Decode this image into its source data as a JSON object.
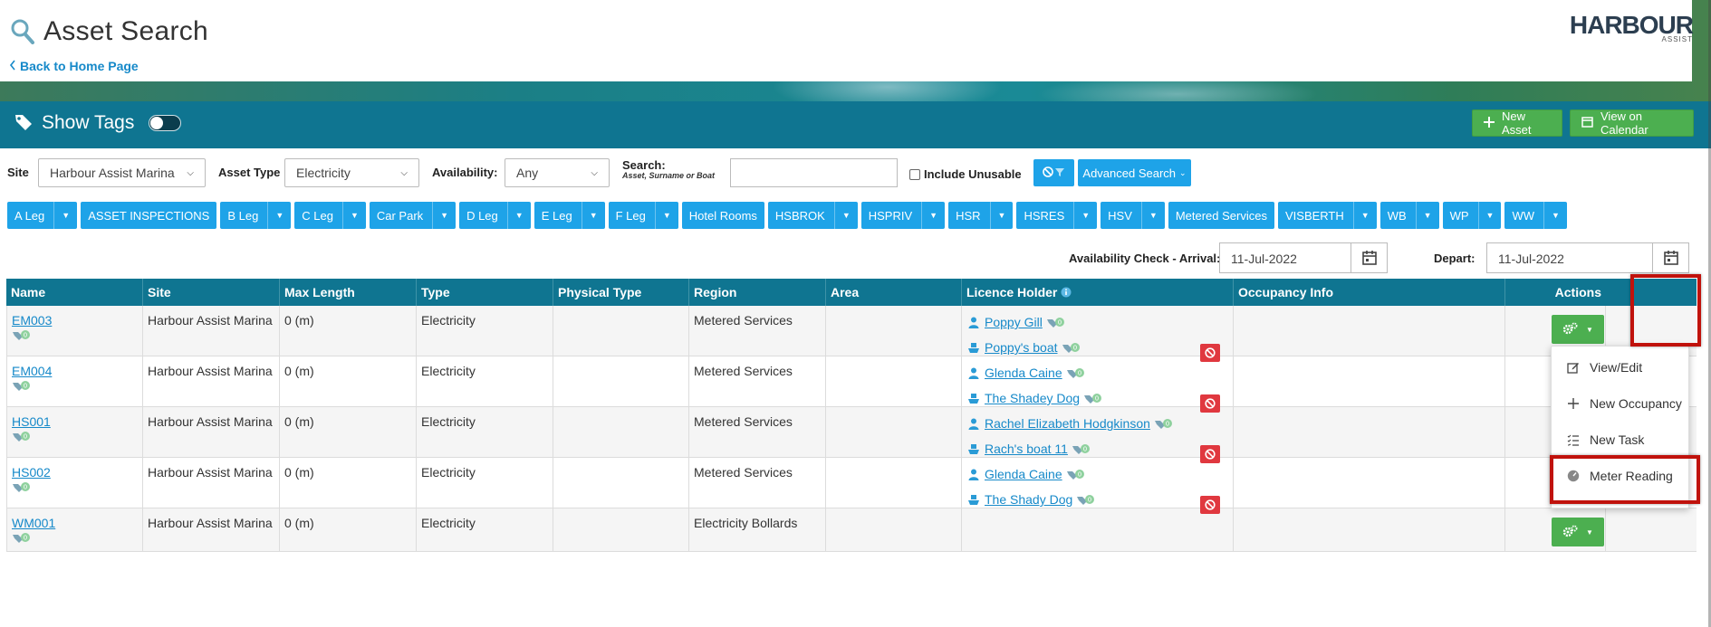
{
  "header": {
    "title": "Asset Search",
    "back_link": "Back to Home Page",
    "logo_word": "HARBOUR",
    "logo_sub": "ASSIST"
  },
  "toolbar": {
    "show_tags": "Show Tags",
    "new_asset": "New Asset",
    "view_calendar": "View on Calendar"
  },
  "filters": {
    "site_label": "Site",
    "site_value": "Harbour Assist Marina",
    "asset_type_label": "Asset Type",
    "asset_type_value": "Electricity",
    "availability_label": "Availability:",
    "availability_value": "Any",
    "search_label": "Search:",
    "search_hint": "Asset, Surname or Boat",
    "search_value": "",
    "include_unusable": "Include Unusable",
    "advanced_search": "Advanced Search"
  },
  "region_tags": [
    {
      "label": "A Leg",
      "caret": true
    },
    {
      "label": "ASSET INSPECTIONS",
      "caret": false
    },
    {
      "label": "B Leg",
      "caret": true
    },
    {
      "label": "C Leg",
      "caret": true
    },
    {
      "label": "Car Park",
      "caret": true
    },
    {
      "label": "D Leg",
      "caret": true
    },
    {
      "label": "E Leg",
      "caret": true
    },
    {
      "label": "F Leg",
      "caret": true
    },
    {
      "label": "Hotel Rooms",
      "caret": false
    },
    {
      "label": "HSBROK",
      "caret": true
    },
    {
      "label": "HSPRIV",
      "caret": true
    },
    {
      "label": "HSR",
      "caret": true
    },
    {
      "label": "HSRES",
      "caret": true
    },
    {
      "label": "HSV",
      "caret": true
    },
    {
      "label": "Metered Services",
      "caret": false
    },
    {
      "label": "VISBERTH",
      "caret": true
    },
    {
      "label": "WB",
      "caret": true
    },
    {
      "label": "WP",
      "caret": true
    },
    {
      "label": "WW",
      "caret": true
    }
  ],
  "availability": {
    "arrival_label": "Availability Check - Arrival:",
    "arrival_value": "11-Jul-2022",
    "depart_label": "Depart:",
    "depart_value": "11-Jul-2022"
  },
  "table": {
    "columns": [
      "Name",
      "Site",
      "Max Length",
      "Type",
      "Physical Type",
      "Region",
      "Area",
      "Licence Holder",
      "Occupancy Info",
      "Actions"
    ],
    "rows": [
      {
        "name": "EM003",
        "site": "Harbour Assist Marina",
        "max_length": "0 (m)",
        "type": "Electricity",
        "physical_type": "",
        "region": "Metered Services",
        "area": "",
        "holder": "Poppy Gill",
        "boat": "Poppy's boat",
        "occupancy": "",
        "tag_count": "0",
        "holder_count": "0",
        "boat_count": "0"
      },
      {
        "name": "EM004",
        "site": "Harbour Assist Marina",
        "max_length": "0 (m)",
        "type": "Electricity",
        "physical_type": "",
        "region": "Metered Services",
        "area": "",
        "holder": "Glenda Caine",
        "boat": "The Shadey Dog",
        "occupancy": "",
        "tag_count": "0",
        "holder_count": "0",
        "boat_count": "0"
      },
      {
        "name": "HS001",
        "site": "Harbour Assist Marina",
        "max_length": "0 (m)",
        "type": "Electricity",
        "physical_type": "",
        "region": "Metered Services",
        "area": "",
        "holder": "Rachel Elizabeth Hodgkinson",
        "boat": "Rach's boat 11",
        "occupancy": "",
        "tag_count": "0",
        "holder_count": "0",
        "boat_count": "0"
      },
      {
        "name": "HS002",
        "site": "Harbour Assist Marina",
        "max_length": "0 (m)",
        "type": "Electricity",
        "physical_type": "",
        "region": "Metered Services",
        "area": "",
        "holder": "Glenda Caine",
        "boat": "The Shady Dog",
        "occupancy": "",
        "tag_count": "0",
        "holder_count": "0",
        "boat_count": "0"
      },
      {
        "name": "WM001",
        "site": "Harbour Assist Marina",
        "max_length": "0 (m)",
        "type": "Electricity",
        "physical_type": "",
        "region": "Electricity Bollards",
        "area": "",
        "holder": "",
        "boat": "",
        "occupancy": "",
        "tag_count": "0",
        "holder_count": "",
        "boat_count": ""
      }
    ]
  },
  "actions_menu": {
    "items": [
      {
        "label": "View/Edit",
        "icon": "edit-icon"
      },
      {
        "label": "New Occupancy",
        "icon": "plus-icon"
      },
      {
        "label": "New Task",
        "icon": "task-list-icon"
      },
      {
        "label": "Meter Reading",
        "icon": "gauge-icon"
      }
    ]
  },
  "colors": {
    "teal": "#0f7591",
    "blue_button": "#1ea3e8",
    "green_button": "#4caf50",
    "red_button": "#e0383f",
    "highlight": "#c0120c"
  }
}
